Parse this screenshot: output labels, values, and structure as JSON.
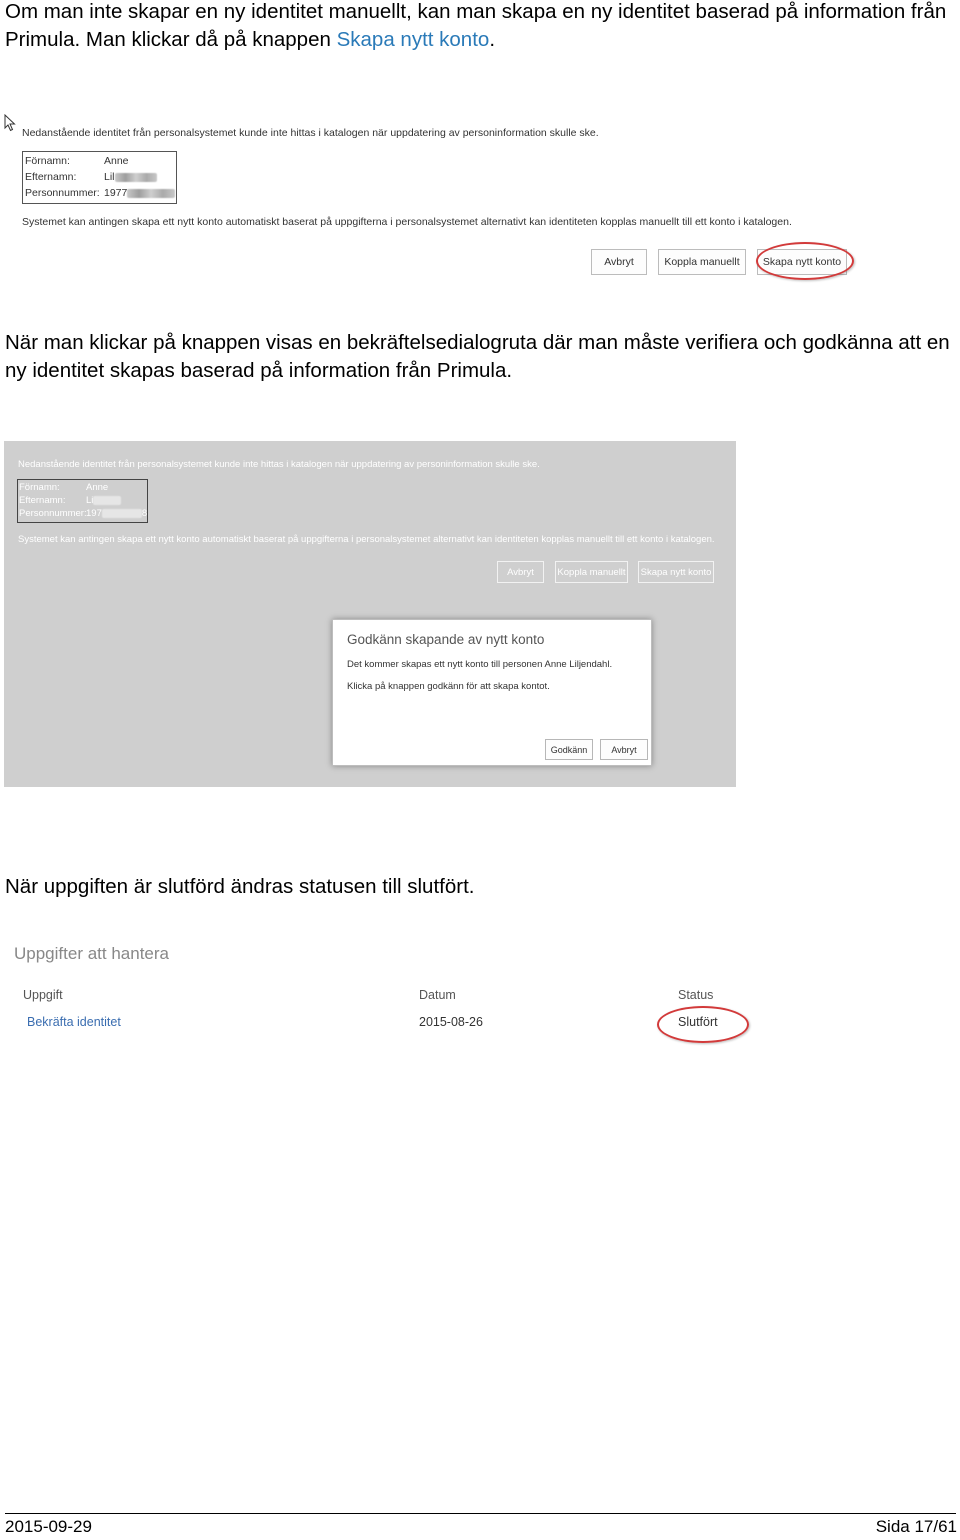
{
  "intro": {
    "text_before": "Om man inte skapar en ny identitet manuellt, kan man skapa en ny identitet baserad på information från Primula. Man klickar då på knappen ",
    "link_text": "Skapa nytt konto",
    "text_after": "."
  },
  "screen1": {
    "notice": "Nedanstående identitet från personalsystemet kunde inte hittas i katalogen när uppdatering av personinformation skulle ske.",
    "fields": [
      {
        "label": "Förnamn:",
        "value": "Anne"
      },
      {
        "label": "Efternamn:",
        "value": "Lil"
      },
      {
        "label": "Personnummer:",
        "value": "1977"
      }
    ],
    "info": "Systemet kan antingen skapa ett nytt konto automatiskt baserat på uppgifterna i personalsystemet alternativt kan identiteten kopplas manuellt till ett konto i katalogen.",
    "buttons": {
      "cancel": "Avbryt",
      "link_manual": "Koppla manuellt",
      "create": "Skapa nytt konto"
    }
  },
  "middle_text": "När man klickar på knappen visas en bekräftelsedialogruta där man måste verifiera och godkänna att en ny identitet skapas baserad på information från Primula.",
  "screen2": {
    "notice": "Nedanstående identitet från personalsystemet kunde inte hittas i katalogen när uppdatering av personinformation skulle ske.",
    "fields": [
      {
        "label": "Förnamn:",
        "value": "Anne"
      },
      {
        "label": "Efternamn:",
        "value": "Li"
      },
      {
        "label": "Personnummer:",
        "value": "197"
      }
    ],
    "field_suffix": "8",
    "info": "Systemet kan antingen skapa ett nytt konto automatiskt baserat på uppgifterna i personalsystemet alternativt kan identiteten kopplas manuellt till ett konto i katalogen.",
    "buttons": {
      "cancel": "Avbryt",
      "link_manual": "Koppla manuellt",
      "create": "Skapa nytt konto"
    },
    "dialog": {
      "title": "Godkänn skapande av nytt konto",
      "line1": "Det kommer skapas ett nytt konto till personen Anne Liljendahl.",
      "line2": "Klicka på knappen godkänn för att skapa kontot.",
      "approve": "Godkänn",
      "cancel": "Avbryt"
    }
  },
  "done_text": "När uppgiften är slutförd ändras statusen till slutfört.",
  "screen3": {
    "title": "Uppgifter att hantera",
    "columns": {
      "task": "Uppgift",
      "date": "Datum",
      "status": "Status"
    },
    "row": {
      "task": "Bekräfta identitet",
      "date": "2015-08-26",
      "status": "Slutfört"
    }
  },
  "footer": {
    "date": "2015-09-29",
    "page": "Sida 17/61"
  },
  "colors": {
    "link": "#2a7ab8",
    "highlight_ring": "#d23a3a"
  }
}
